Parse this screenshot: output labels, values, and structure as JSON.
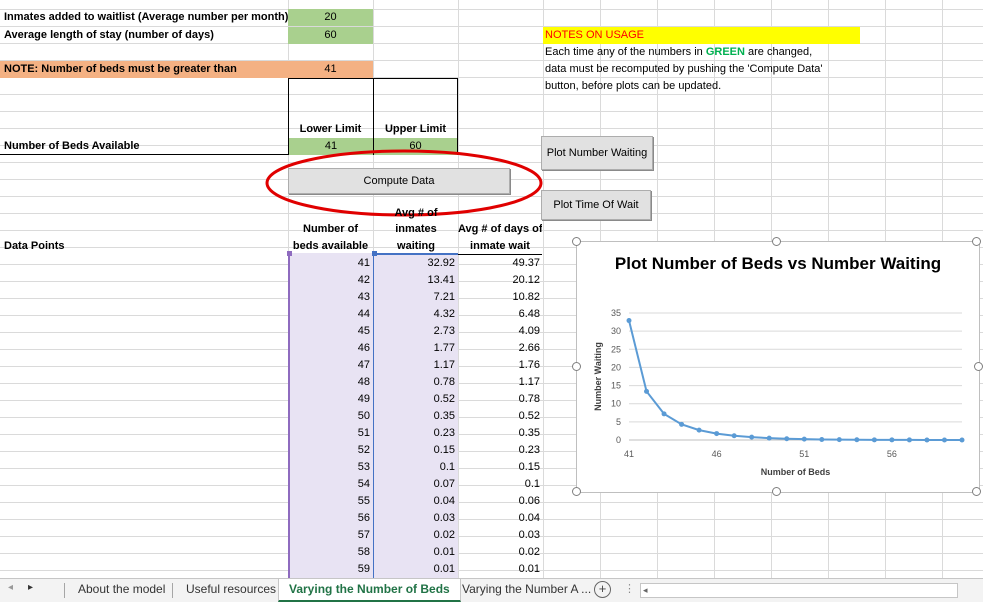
{
  "params": {
    "inmates_label": "Inmates added to waitlist (Average number per month)",
    "inmates_value": "20",
    "stay_label": "Average length of stay (number of days)",
    "stay_value": "60",
    "note_label": "NOTE: Number of beds must be greater than",
    "note_value": "41",
    "lower_label": "Lower Limit",
    "upper_label": "Upper Limit",
    "beds_label": "Number of Beds Available",
    "lower_value": "41",
    "upper_value": "60"
  },
  "notes": {
    "heading": "NOTES ON USAGE",
    "line1_a": "Each time any of the numbers in ",
    "line1_green": "GREEN",
    "line1_b": " are changed,",
    "line2": "data must be recomputed by pushing the 'Compute Data'",
    "line3": "button, before plots can be updated."
  },
  "buttons": {
    "compute": "Compute Data",
    "plot_waiting": "Plot Number Waiting",
    "plot_wait_time": "Plot Time Of Wait"
  },
  "table": {
    "data_points_label": "Data Points",
    "col1_h1": "Number of",
    "col1_h2": "beds available",
    "col2_h1": "Avg # of",
    "col2_h2": "inmates",
    "col2_h3": "waiting",
    "col3_h1": "Avg # of days of",
    "col3_h2": "inmate wait",
    "rows": [
      [
        "41",
        "32.92",
        "49.37"
      ],
      [
        "42",
        "13.41",
        "20.12"
      ],
      [
        "43",
        "7.21",
        "10.82"
      ],
      [
        "44",
        "4.32",
        "6.48"
      ],
      [
        "45",
        "2.73",
        "4.09"
      ],
      [
        "46",
        "1.77",
        "2.66"
      ],
      [
        "47",
        "1.17",
        "1.76"
      ],
      [
        "48",
        "0.78",
        "1.17"
      ],
      [
        "49",
        "0.52",
        "0.78"
      ],
      [
        "50",
        "0.35",
        "0.52"
      ],
      [
        "51",
        "0.23",
        "0.35"
      ],
      [
        "52",
        "0.15",
        "0.23"
      ],
      [
        "53",
        "0.1",
        "0.15"
      ],
      [
        "54",
        "0.07",
        "0.1"
      ],
      [
        "55",
        "0.04",
        "0.06"
      ],
      [
        "56",
        "0.03",
        "0.04"
      ],
      [
        "57",
        "0.02",
        "0.03"
      ],
      [
        "58",
        "0.01",
        "0.02"
      ],
      [
        "59",
        "0.01",
        "0.01"
      ]
    ]
  },
  "chart_data": {
    "type": "line",
    "title": "Plot Number of Beds vs Number Waiting",
    "xlabel": "Number of Beds",
    "ylabel": "Number Waiting",
    "x": [
      41,
      42,
      43,
      44,
      45,
      46,
      47,
      48,
      49,
      50,
      51,
      52,
      53,
      54,
      55,
      56,
      57,
      58,
      59,
      60
    ],
    "values": [
      32.92,
      13.41,
      7.21,
      4.32,
      2.73,
      1.77,
      1.17,
      0.78,
      0.52,
      0.35,
      0.23,
      0.15,
      0.1,
      0.07,
      0.04,
      0.03,
      0.02,
      0.01,
      0.01,
      0.0
    ],
    "xtick_labels": [
      "41",
      "46",
      "51",
      "56"
    ],
    "ytick_labels": [
      "0",
      "5",
      "10",
      "15",
      "20",
      "25",
      "30",
      "35"
    ],
    "ylim": [
      0,
      35
    ],
    "grid": true,
    "series_color": "#5b9bd5"
  },
  "tabs": {
    "items": [
      "About the model",
      "Useful resources",
      "Varying the Number of Beds",
      "Varying the Number A ..."
    ],
    "active_index": 2
  },
  "colors": {
    "green_fill": "#a9d08e",
    "orange_fill": "#f4b183",
    "yellow_fill": "#ffff00",
    "highlight_circle": "#e00000",
    "active_tab": "#217346"
  }
}
